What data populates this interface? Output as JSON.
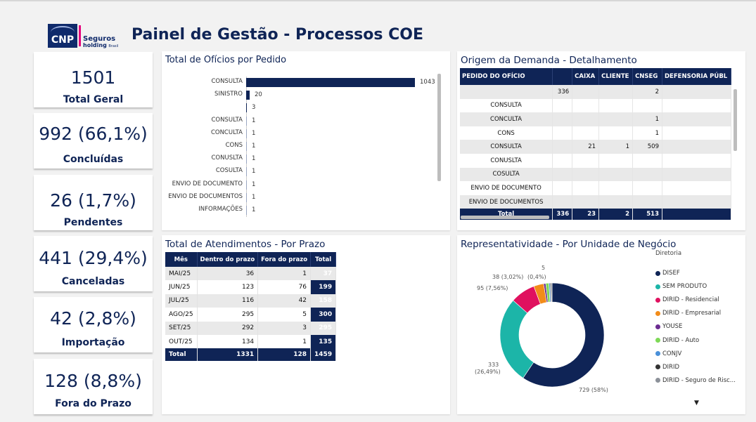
{
  "header": {
    "title": "Painel de Gestão - Processos COE",
    "logo_brand": "CNP",
    "logo_line1": "Seguros",
    "logo_line2": "holding",
    "logo_line3": "Brasil"
  },
  "kpis": [
    {
      "value": "1501",
      "label": "Total Geral"
    },
    {
      "value": "992 (66,1%)",
      "label": "Concluídas"
    },
    {
      "value": "26 (1,7%)",
      "label": "Pendentes"
    },
    {
      "value": "441 (29,4%)",
      "label": "Canceladas"
    },
    {
      "value": "42 (2,8%)",
      "label": "Importação"
    },
    {
      "value": "128 (8,8%)",
      "label": "Fora do Prazo"
    }
  ],
  "oficios_panel": {
    "title": "Total de Ofícios por Pedido"
  },
  "chart_data": {
    "type": "bar",
    "orientation": "horizontal",
    "title": "Total de Ofícios por Pedido",
    "categories": [
      "CONSULTA",
      "SINISTRO",
      "",
      "CONSULTA",
      "CONCULTA",
      "CONS",
      "CONUSLTA",
      "COSULTA",
      "ENVIO DE DOCUMENTO",
      "ENVIO DE DOCUMENTOS",
      "INFORMAÇÕES"
    ],
    "values": [
      1043,
      20,
      3,
      1,
      1,
      1,
      1,
      1,
      1,
      1,
      1
    ],
    "xlim": [
      0,
      1043
    ]
  },
  "origem_panel": {
    "title": "Origem da Demanda - Detalhamento",
    "columns": [
      "PEDIDO DO OFÍCIO",
      "",
      "CAIXA",
      "CLIENTE",
      "CNSEG",
      "DEFENSORIA PÚBL"
    ],
    "rows": [
      [
        "",
        "336",
        "",
        "",
        "2",
        ""
      ],
      [
        "CONSULTA",
        "",
        "",
        "",
        "",
        ""
      ],
      [
        "CONCULTA",
        "",
        "",
        "",
        "1",
        ""
      ],
      [
        "CONS",
        "",
        "",
        "",
        "1",
        ""
      ],
      [
        "CONSULTA",
        "",
        "21",
        "1",
        "509",
        ""
      ],
      [
        "CONUSLTA",
        "",
        "",
        "",
        "",
        ""
      ],
      [
        "COSULTA",
        "",
        "",
        "",
        "",
        ""
      ],
      [
        "ENVIO DE DOCUMENTO",
        "",
        "",
        "",
        "",
        ""
      ],
      [
        "ENVIO DE DOCUMENTOS",
        "",
        "",
        "",
        "",
        ""
      ]
    ],
    "total": [
      "Total",
      "336",
      "23",
      "2",
      "513",
      ""
    ]
  },
  "prazo_panel": {
    "title": "Total de Atendimentos - Por Prazo",
    "columns": [
      "Mês",
      "Dentro do prazo",
      "Fora do prazo",
      "Total"
    ],
    "rows": [
      [
        "MAI/25",
        "36",
        "1",
        "37"
      ],
      [
        "JUN/25",
        "123",
        "76",
        "199"
      ],
      [
        "JUL/25",
        "116",
        "42",
        "158"
      ],
      [
        "AGO/25",
        "295",
        "5",
        "300"
      ],
      [
        "SET/25",
        "292",
        "3",
        "295"
      ],
      [
        "OUT/25",
        "134",
        "1",
        "135"
      ]
    ],
    "total": [
      "Total",
      "1331",
      "128",
      "1459"
    ]
  },
  "rep_panel": {
    "title": "Representatividade - Por Unidade de Negócio",
    "legend_title": "Diretoria",
    "legend": [
      {
        "name": "DISEF",
        "color": "#0f2456"
      },
      {
        "name": "SEM PRODUTO",
        "color": "#1cb5a8"
      },
      {
        "name": "DIRID - Residencial",
        "color": "#e0115f"
      },
      {
        "name": "DIRID - Empresarial",
        "color": "#f28c1a"
      },
      {
        "name": "YOUSE",
        "color": "#6b2c91"
      },
      {
        "name": "DIRID - Auto",
        "color": "#7ed957"
      },
      {
        "name": "CONJV",
        "color": "#4a90d9"
      },
      {
        "name": "DIRID",
        "color": "#333333"
      },
      {
        "name": "DIRID - Seguro de Risc...",
        "color": "#8c9199"
      }
    ],
    "annotations": [
      "729 (58%)",
      "333",
      "(26,49%)",
      "95 (7,56%)",
      "38 (3,02%)",
      "(0,4%)",
      "5"
    ],
    "slices": [
      {
        "name": "DISEF",
        "value": 729,
        "color": "#0f2456"
      },
      {
        "name": "SEM PRODUTO",
        "value": 333,
        "color": "#1cb5a8"
      },
      {
        "name": "DIRID - Residencial",
        "value": 95,
        "color": "#e0115f"
      },
      {
        "name": "DIRID - Empresarial",
        "value": 38,
        "color": "#f28c1a"
      },
      {
        "name": "YOUSE",
        "value": 8,
        "color": "#6b2c91"
      },
      {
        "name": "DIRID - Auto",
        "value": 12,
        "color": "#7ed957"
      },
      {
        "name": "CONJV",
        "value": 5,
        "color": "#4a90d9"
      },
      {
        "name": "DIRID",
        "value": 4,
        "color": "#333333"
      },
      {
        "name": "DIRID - Seguro de Risc...",
        "value": 3,
        "color": "#8c9199"
      }
    ]
  }
}
